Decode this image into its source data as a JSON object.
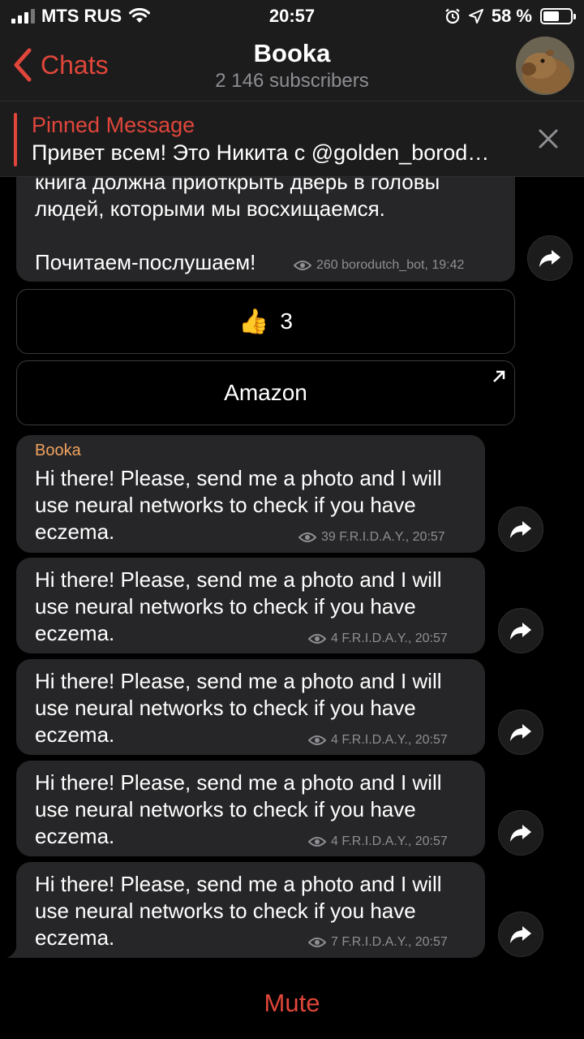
{
  "status_bar": {
    "carrier": "MTS RUS",
    "time": "20:57",
    "battery": "58 %",
    "battery_level": 0.58
  },
  "nav": {
    "back_label": "Chats",
    "title": "Booka",
    "subtitle": "2 146 subscribers"
  },
  "pinned": {
    "title": "Pinned Message",
    "text": "Привет всем! Это Никита с @golden_borod…"
  },
  "prev_message": {
    "line1": "книга должна приоткрыть дверь в головы",
    "line2": "людей, которыми мы восхищаемся.",
    "line3": "Почитаем-послушаем!",
    "meta": "260 borodutch_bot, 19:42"
  },
  "reaction_button": {
    "emoji": "👍",
    "count": "3"
  },
  "link_button": {
    "label": "Amazon"
  },
  "messages": [
    {
      "sender": "Booka",
      "line1": "Hi there! Please, send me a photo and I will",
      "line2": "use neural networks to check if you have",
      "line3": "eczema.",
      "meta": "39 F.R.I.D.A.Y., 20:57"
    },
    {
      "line1": "Hi there! Please, send me a photo and I will",
      "line2": "use neural networks to check if you have",
      "line3": "eczema.",
      "meta": "4 F.R.I.D.A.Y., 20:57"
    },
    {
      "line1": "Hi there! Please, send me a photo and I will",
      "line2": "use neural networks to check if you have",
      "line3": "eczema.",
      "meta": "4 F.R.I.D.A.Y., 20:57"
    },
    {
      "line1": "Hi there! Please, send me a photo and I will",
      "line2": "use neural networks to check if you have",
      "line3": "eczema.",
      "meta": "4 F.R.I.D.A.Y., 20:57"
    },
    {
      "line1": "Hi there! Please, send me a photo and I will",
      "line2": "use neural networks to check if you have",
      "line3": "eczema.",
      "meta": "7 F.R.I.D.A.Y., 20:57"
    }
  ],
  "bottom": {
    "mute_label": "Mute"
  },
  "colors": {
    "accent": "#e0463a",
    "sender": "#f0a35e",
    "bubble": "#262628"
  }
}
